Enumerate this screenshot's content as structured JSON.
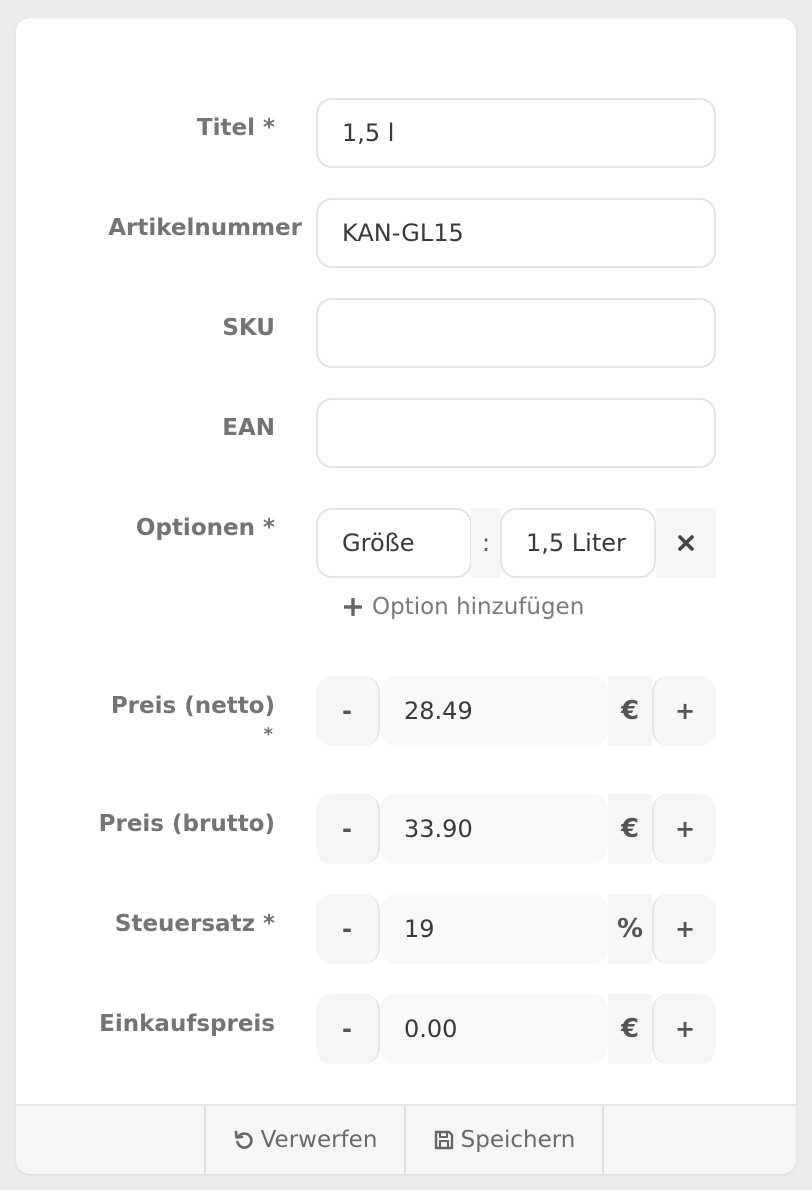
{
  "form": {
    "fields": {
      "title": {
        "label": "Titel *",
        "value": "1,5 l"
      },
      "article_number": {
        "label": "Artikelnummer",
        "value": "KAN-GL15"
      },
      "sku": {
        "label": "SKU",
        "value": ""
      },
      "ean": {
        "label": "EAN",
        "value": ""
      }
    },
    "options": {
      "label": "Optionen *",
      "items": [
        {
          "name": "Größe",
          "separator": ":",
          "value": "1,5 Liter"
        }
      ],
      "add_label": "Option hinzufügen"
    },
    "price_net": {
      "label_line1": "Preis (netto)",
      "label_line2": "*",
      "value": "28.49",
      "unit": "€",
      "minus": "-",
      "plus": "+"
    },
    "price_gross": {
      "label": "Preis (brutto)",
      "value": "33.90",
      "unit": "€",
      "minus": "-",
      "plus": "+"
    },
    "tax_rate": {
      "label": "Steuersatz *",
      "value": "19",
      "unit": "%",
      "minus": "-",
      "plus": "+"
    },
    "purchase_price": {
      "label": "Einkaufspreis",
      "value": "0.00",
      "unit": "€",
      "minus": "-",
      "plus": "+"
    }
  },
  "footer": {
    "discard_label": "Verwerfen",
    "save_label": "Speichern"
  },
  "icons": {
    "remove": "close-icon",
    "add": "plus-icon",
    "discard": "undo-icon",
    "save": "floppy-disk-icon"
  }
}
